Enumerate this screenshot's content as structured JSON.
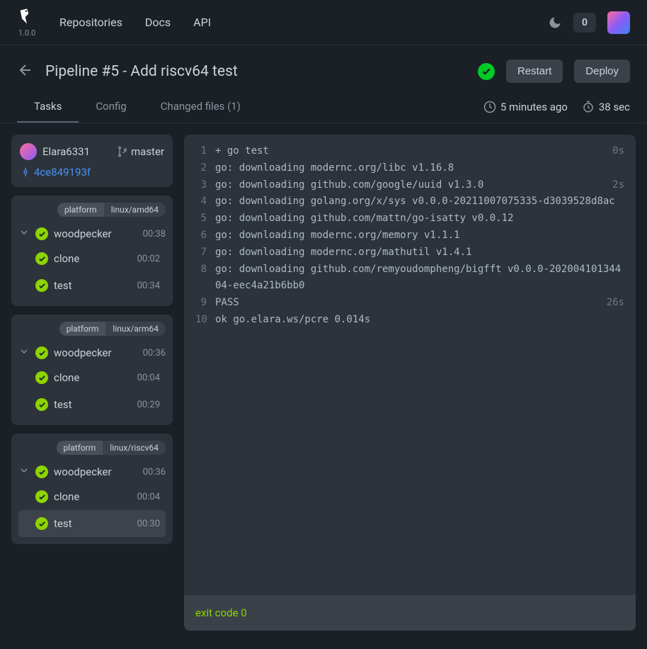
{
  "nav": {
    "version": "1.0.0",
    "links": [
      "Repositories",
      "Docs",
      "API"
    ],
    "badge": "0"
  },
  "header": {
    "title": "Pipeline #5  -  Add riscv64 test",
    "restart": "Restart",
    "deploy": "Deploy"
  },
  "tabs": {
    "items": [
      "Tasks",
      "Config",
      "Changed files (1)"
    ],
    "time_ago": "5 minutes ago",
    "duration": "38 sec"
  },
  "repo": {
    "author": "Elara6331",
    "branch": "master",
    "commit": "4ce849193f"
  },
  "platforms": [
    {
      "label": "platform",
      "value": "linux/amd64",
      "name": "woodpecker",
      "total": "00:38",
      "tasks": [
        {
          "name": "clone",
          "time": "00:02"
        },
        {
          "name": "test",
          "time": "00:34"
        }
      ]
    },
    {
      "label": "platform",
      "value": "linux/arm64",
      "name": "woodpecker",
      "total": "00:36",
      "tasks": [
        {
          "name": "clone",
          "time": "00:04"
        },
        {
          "name": "test",
          "time": "00:29"
        }
      ]
    },
    {
      "label": "platform",
      "value": "linux/riscv64",
      "name": "woodpecker",
      "total": "00:36",
      "tasks": [
        {
          "name": "clone",
          "time": "00:04"
        },
        {
          "name": "test",
          "time": "00:30",
          "selected": true
        }
      ]
    }
  ],
  "log": {
    "lines": [
      {
        "n": "1",
        "text": "+ go test",
        "t": "0s"
      },
      {
        "n": "2",
        "text": "go: downloading modernc.org/libc v1.16.8"
      },
      {
        "n": "3",
        "text": "go: downloading github.com/google/uuid v1.3.0",
        "t": "2s"
      },
      {
        "n": "4",
        "text": "go: downloading golang.org/x/sys v0.0.0-20211007075335-d3039528d8ac"
      },
      {
        "n": "5",
        "text": "go: downloading github.com/mattn/go-isatty v0.0.12"
      },
      {
        "n": "6",
        "text": "go: downloading modernc.org/memory v1.1.1"
      },
      {
        "n": "7",
        "text": "go: downloading modernc.org/mathutil v1.4.1"
      },
      {
        "n": "8",
        "text": "go: downloading github.com/remyoudompheng/bigfft v0.0.0-20200410134404-eec4a21b6bb0"
      },
      {
        "n": "9",
        "text": "PASS",
        "t": "26s"
      },
      {
        "n": "10",
        "text": "ok  \tgo.elara.ws/pcre\t0.014s"
      }
    ],
    "exit": "exit code 0"
  }
}
